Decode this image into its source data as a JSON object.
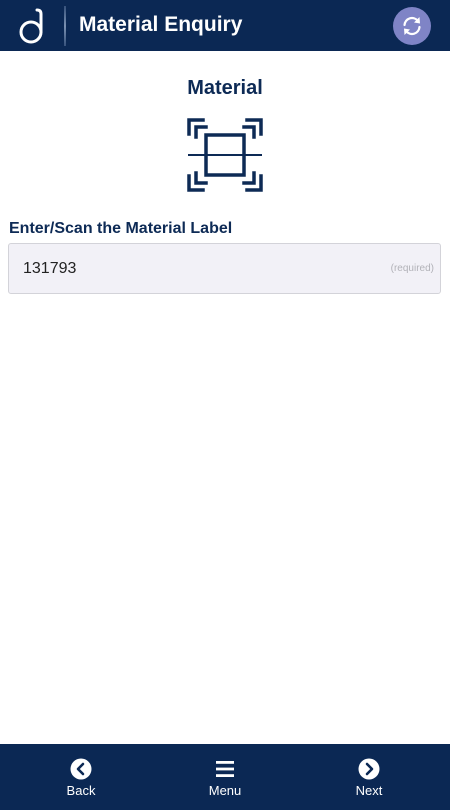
{
  "header": {
    "title": "Material Enquiry",
    "logo_icon": "brand-d-logo",
    "refresh_icon": "refresh-icon",
    "background": "#0b2854",
    "refresh_color": "#7f84c6"
  },
  "content": {
    "section_title": "Material",
    "scan_icon": "barcode-scan-icon",
    "field_label": "Enter/Scan the Material Label",
    "field_value": "131793",
    "field_hint": "(required)"
  },
  "footer": {
    "back_label": "Back",
    "menu_label": "Menu",
    "next_label": "Next",
    "back_icon": "chevron-left-circle-icon",
    "menu_icon": "hamburger-menu-icon",
    "next_icon": "chevron-right-circle-icon"
  }
}
